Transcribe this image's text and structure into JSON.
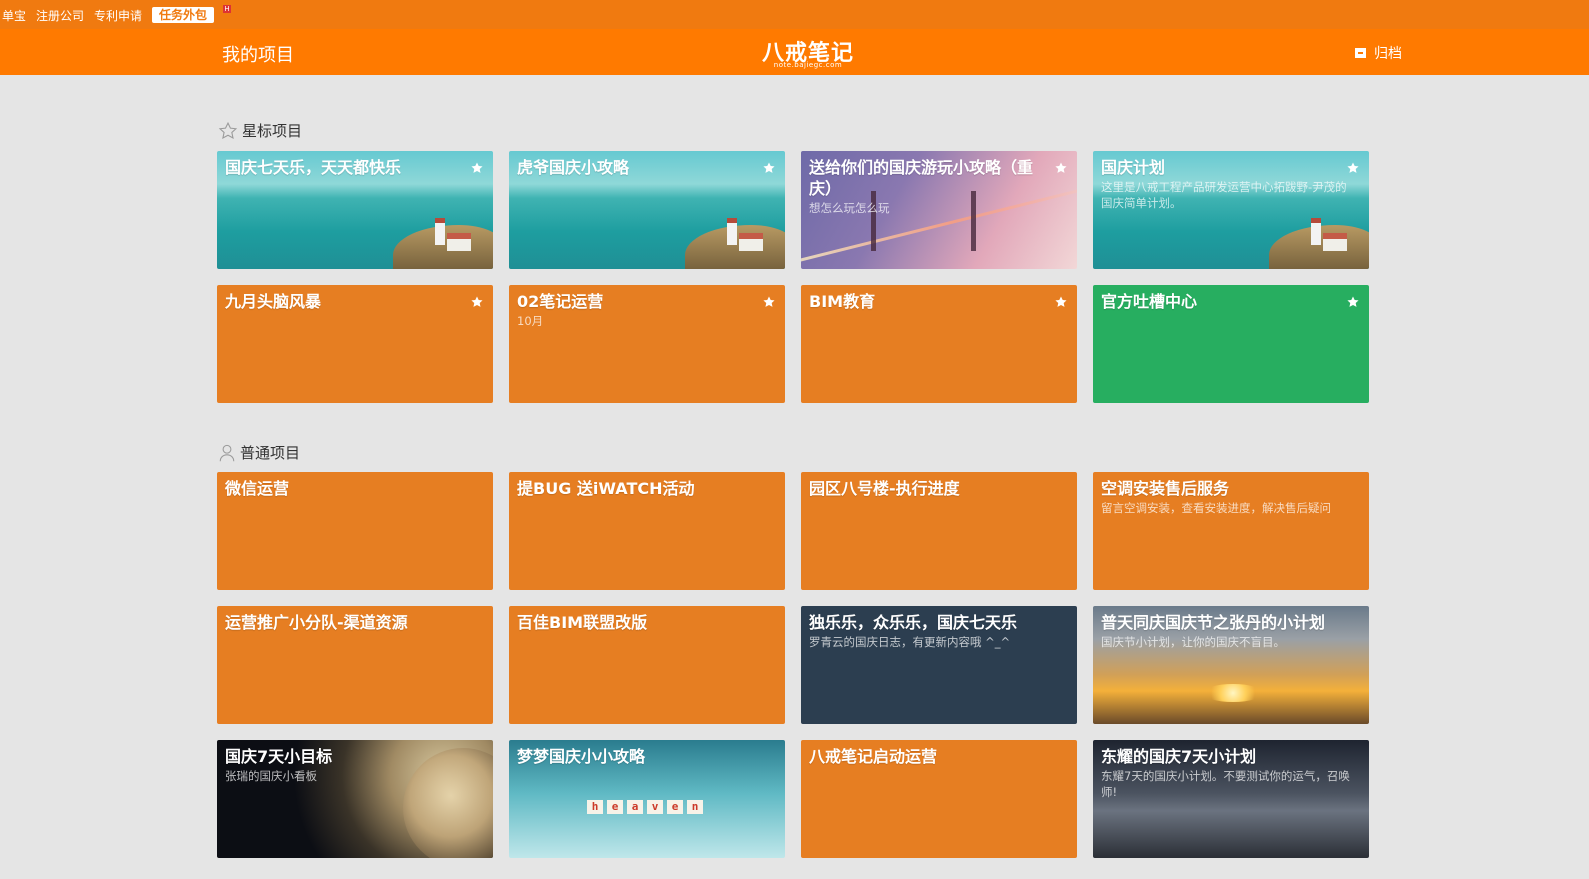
{
  "topbar": {
    "links": [
      "单宝",
      "注册公司",
      "专利申请"
    ],
    "badge": "任务外包",
    "badge_mark": "H"
  },
  "header": {
    "title": "我的项目",
    "logo_text": "八戒笔记",
    "logo_sub": "note.bajiegc.com",
    "archive_label": "归档"
  },
  "sections": {
    "starred_label": "星标项目",
    "normal_label": "普通项目"
  },
  "starred_cards": [
    {
      "title": "国庆七天乐，天天都快乐",
      "desc": "",
      "bg": "sea"
    },
    {
      "title": "虎爷国庆小攻略",
      "desc": "",
      "bg": "sea"
    },
    {
      "title": "送给你们的国庆游玩小攻略（重庆）",
      "desc": "想怎么玩怎么玩",
      "bg": "bridge"
    },
    {
      "title": "国庆计划",
      "desc": "这里是八戒工程产品研发运营中心拓跋野-尹茂的国庆简单计划。",
      "bg": "sea"
    },
    {
      "title": "九月头脑风暴",
      "desc": "",
      "bg": "orange"
    },
    {
      "title": "02笔记运营",
      "desc": "10月",
      "bg": "orange"
    },
    {
      "title": "BIM教育",
      "desc": "",
      "bg": "orange"
    },
    {
      "title": "官方吐槽中心",
      "desc": "",
      "bg": "green"
    }
  ],
  "normal_cards": [
    {
      "title": "微信运营",
      "desc": "",
      "bg": "orange"
    },
    {
      "title": "提BUG 送iWATCH活动",
      "desc": "",
      "bg": "orange"
    },
    {
      "title": "园区八号楼-执行进度",
      "desc": "",
      "bg": "orange"
    },
    {
      "title": "空调安装售后服务",
      "desc": "留言空调安装，查看安装进度，解决售后疑问",
      "bg": "orange"
    },
    {
      "title": "运营推广小分队-渠道资源",
      "desc": "",
      "bg": "orange"
    },
    {
      "title": "百佳BIM联盟改版",
      "desc": "",
      "bg": "orange"
    },
    {
      "title": "独乐乐，众乐乐，国庆七天乐",
      "desc": "罗青云的国庆日志，有更新内容哦 ^_^",
      "bg": "navy"
    },
    {
      "title": "普天同庆国庆节之张丹的小计划",
      "desc": "国庆节小计划，让你的国庆不盲目。",
      "bg": "sunset"
    },
    {
      "title": "国庆7天小目标",
      "desc": "张瑞的国庆小看板",
      "bg": "space"
    },
    {
      "title": "梦梦国庆小小攻略",
      "desc": "",
      "bg": "sky"
    },
    {
      "title": "八戒笔记启动运营",
      "desc": "",
      "bg": "orange"
    },
    {
      "title": "东耀的国庆7天小计划",
      "desc": "东耀7天的国庆小计划。不要测试你的运气，召唤师!",
      "bg": "milky"
    }
  ],
  "heaven_letters": [
    "h",
    "e",
    "a",
    "v",
    "e",
    "n"
  ],
  "colors": {
    "topbar": "#f07a10",
    "header": "#ff7a00",
    "card_orange": "#e67e22",
    "card_green": "#27ae60",
    "card_navy": "#2c3e50",
    "page_bg": "#e5e5e5"
  }
}
